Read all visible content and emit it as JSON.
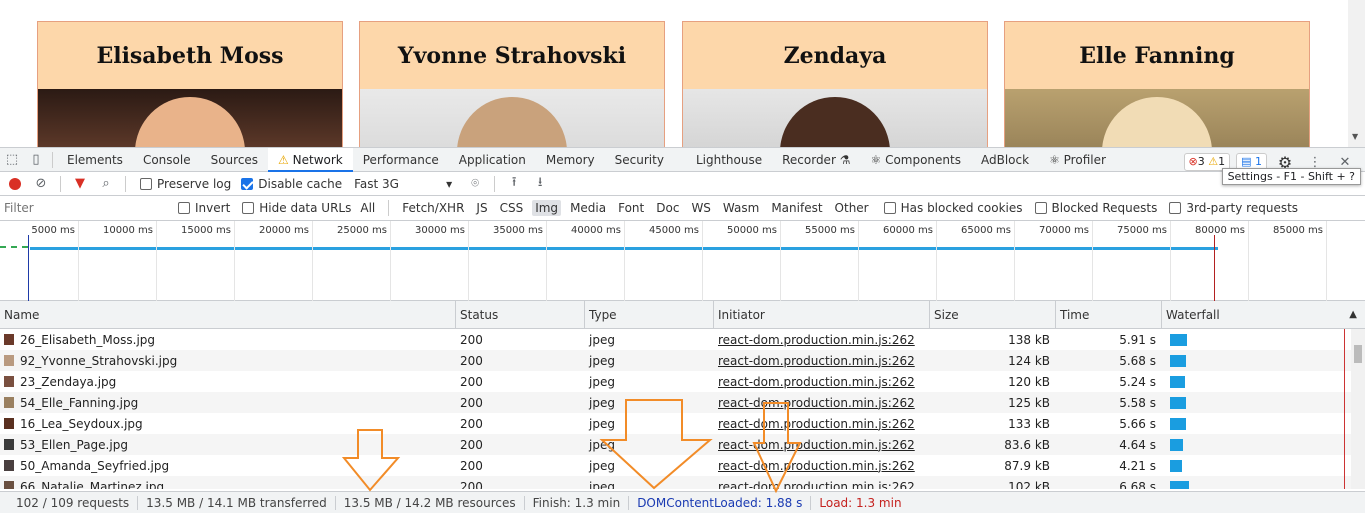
{
  "page": {
    "cards": [
      {
        "name": "Elisabeth Moss"
      },
      {
        "name": "Yvonne Strahovski"
      },
      {
        "name": "Zendaya"
      },
      {
        "name": "Elle Fanning"
      }
    ]
  },
  "devtools": {
    "tabs": [
      "Elements",
      "Console",
      "Sources",
      "Network",
      "Performance",
      "Application",
      "Memory",
      "Security",
      "Lighthouse",
      "Recorder",
      "Components",
      "AdBlock",
      "Profiler"
    ],
    "active_tab": "Network",
    "errors_count": "3",
    "warnings_count": "1",
    "messages_count": "1",
    "tooltip": "Settings - F1 - Shift + ?",
    "toolbar": {
      "preserve_log": "Preserve log",
      "disable_cache": "Disable cache",
      "throttling": "Fast 3G"
    },
    "filterbar": {
      "placeholder": "Filter",
      "invert": "Invert",
      "hide_data_urls": "Hide data URLs",
      "types": [
        "All",
        "Fetch/XHR",
        "JS",
        "CSS",
        "Img",
        "Media",
        "Font",
        "Doc",
        "WS",
        "Wasm",
        "Manifest",
        "Other"
      ],
      "selected_type": "Img",
      "blocked_cookies": "Has blocked cookies",
      "blocked_requests": "Blocked Requests",
      "third_party": "3rd-party requests"
    },
    "timeline_ticks": [
      "5000 ms",
      "10000 ms",
      "15000 ms",
      "20000 ms",
      "25000 ms",
      "30000 ms",
      "35000 ms",
      "40000 ms",
      "45000 ms",
      "50000 ms",
      "55000 ms",
      "60000 ms",
      "65000 ms",
      "70000 ms",
      "75000 ms",
      "80000 ms",
      "85000 ms"
    ],
    "columns": [
      "Name",
      "Status",
      "Type",
      "Initiator",
      "Size",
      "Time",
      "Waterfall"
    ],
    "rows": [
      {
        "name": "26_Elisabeth_Moss.jpg",
        "status": "200",
        "type": "jpeg",
        "initiator": "react-dom.production.min.js:262",
        "size": "138 kB",
        "time": "5.91 s",
        "wf": 0.65
      },
      {
        "name": "92_Yvonne_Strahovski.jpg",
        "status": "200",
        "type": "jpeg",
        "initiator": "react-dom.production.min.js:262",
        "size": "124 kB",
        "time": "5.68 s",
        "wf": 0.62
      },
      {
        "name": "23_Zendaya.jpg",
        "status": "200",
        "type": "jpeg",
        "initiator": "react-dom.production.min.js:262",
        "size": "120 kB",
        "time": "5.24 s",
        "wf": 0.57
      },
      {
        "name": "54_Elle_Fanning.jpg",
        "status": "200",
        "type": "jpeg",
        "initiator": "react-dom.production.min.js:262",
        "size": "125 kB",
        "time": "5.58 s",
        "wf": 0.61
      },
      {
        "name": "16_Lea_Seydoux.jpg",
        "status": "200",
        "type": "jpeg",
        "initiator": "react-dom.production.min.js:262",
        "size": "133 kB",
        "time": "5.66 s",
        "wf": 0.62
      },
      {
        "name": "53_Ellen_Page.jpg",
        "status": "200",
        "type": "jpeg",
        "initiator": "react-dom.production.min.js:262",
        "size": "83.6 kB",
        "time": "4.64 s",
        "wf": 0.51
      },
      {
        "name": "50_Amanda_Seyfried.jpg",
        "status": "200",
        "type": "jpeg",
        "initiator": "react-dom.production.min.js:262",
        "size": "87.9 kB",
        "time": "4.21 s",
        "wf": 0.46
      },
      {
        "name": "66_Natalie_Martinez.jpg",
        "status": "200",
        "type": "jpeg",
        "initiator": "react-dom.production.min.js:262",
        "size": "102 kB",
        "time": "6.68 s",
        "wf": 0.73
      }
    ],
    "status": {
      "requests": "102 / 109 requests",
      "transferred": "13.5 MB / 14.1 MB transferred",
      "resources": "13.5 MB / 14.2 MB resources",
      "finish": "Finish: 1.3 min",
      "dcl": "DOMContentLoaded: 1.88 s",
      "load": "Load: 1.3 min"
    }
  },
  "colors": {
    "annotation_arrow": "#f28c28",
    "card_header": "#fdd7aa",
    "accent": "#1a73e8"
  }
}
